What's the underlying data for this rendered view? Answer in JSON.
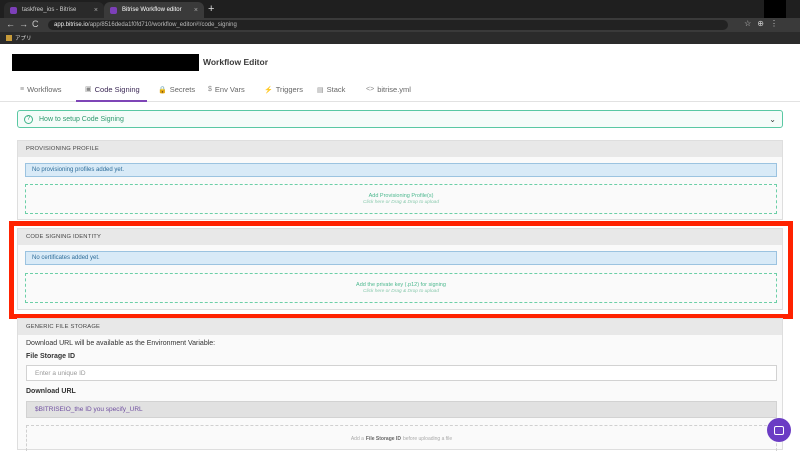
{
  "browser": {
    "tabs": [
      {
        "label": "taskfree_ios - Bitrise",
        "close": "×"
      },
      {
        "label": "Bitrise Workflow editor",
        "close": "×"
      }
    ],
    "new_tab": "+",
    "url_host": "app.bitrise.io",
    "url_path": "/app/8516deda1f0fd710/workflow_editor#!/code_signing",
    "nav": {
      "back": "←",
      "forward": "→",
      "reload": "C"
    },
    "bookmark": "アプリ"
  },
  "header": {
    "title": "Workflow Editor"
  },
  "tabs": [
    {
      "label": "Workflows",
      "icon": "≡"
    },
    {
      "label": "Code Signing",
      "icon": "▣"
    },
    {
      "label": "Secrets",
      "icon": "🔒"
    },
    {
      "label": "Env Vars",
      "icon": "$"
    },
    {
      "label": "Triggers",
      "icon": "⚡"
    },
    {
      "label": "Stack",
      "icon": "▤"
    },
    {
      "label": "bitrise.yml",
      "icon": "<>"
    }
  ],
  "howto": {
    "label": "How to setup Code Signing",
    "icon": "?",
    "chevron": "⌄"
  },
  "provisioning": {
    "heading": "PROVISIONING PROFILE",
    "info": "No provisioning profiles added yet.",
    "drop_title": "Add Provisioning Profile(s)",
    "drop_hint": "Click here or Drag & Drop to upload"
  },
  "identity": {
    "heading": "CODE SIGNING IDENTITY",
    "info": "No certificates added yet.",
    "drop_title": "Add the private key (.p12) for signing",
    "drop_hint": "Click here or Drag & Drop to upload"
  },
  "file_storage": {
    "heading": "GENERIC FILE STORAGE",
    "description": "Download URL will be available as the Environment Variable:",
    "id_label": "File Storage ID",
    "id_placeholder": "Enter a unique ID",
    "url_label": "Download URL",
    "url_value": "$BITRISEIO_the ID you specify_URL",
    "drop_prefix": "Add a",
    "drop_bold": "File Storage ID",
    "drop_suffix": "before uploading a file"
  },
  "colors": {
    "accent": "#7e45b7",
    "green": "#4cb88e",
    "highlight": "#ff2200"
  }
}
